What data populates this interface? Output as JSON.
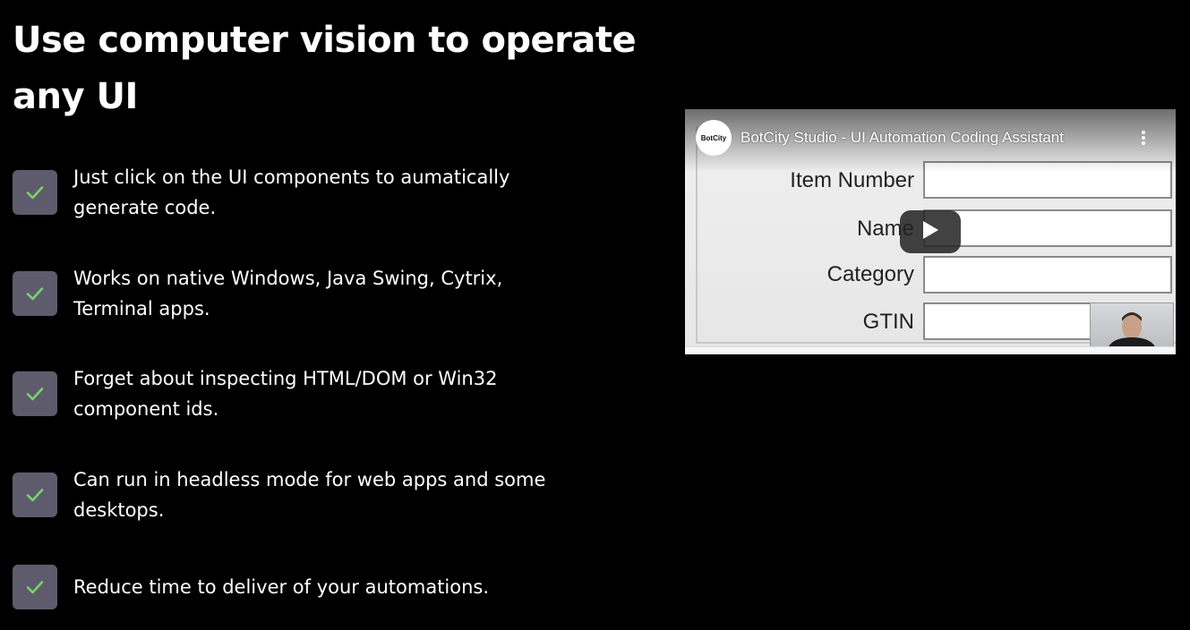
{
  "headline": "Use computer vision to operate any UI",
  "features": [
    {
      "icon": "check-icon",
      "text": "Just click on the UI components to aumatically generate code."
    },
    {
      "icon": "check-icon",
      "text": "Works on native Windows, Java Swing, Cytrix, Terminal apps."
    },
    {
      "icon": "check-icon",
      "text": "Forget about inspecting HTML/DOM or Win32 component ids."
    },
    {
      "icon": "check-icon",
      "text": "Can run in headless mode for web apps and some desktops."
    },
    {
      "icon": "check-icon",
      "text": "Reduce time to deliver of your automations."
    }
  ],
  "video": {
    "title": "BotCity Studio - UI Automation Coding Assistant",
    "channel_logo_text": "BotCity",
    "form_fields": [
      "Item Number",
      "Name",
      "Category",
      "GTIN"
    ],
    "play_icon": "play-icon",
    "more_icon": "more-vertical-icon"
  },
  "colors": {
    "background": "#000000",
    "text": "#ffffff",
    "check_box": "#5e5c6c",
    "check_mark": "#7ad36a"
  }
}
